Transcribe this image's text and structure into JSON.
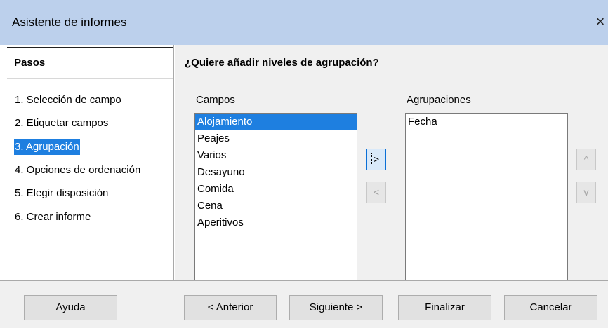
{
  "window": {
    "title": "Asistente de informes",
    "close_glyph": "×"
  },
  "steps": {
    "heading": "Pasos",
    "items": [
      {
        "label": "1. Selección de campo"
      },
      {
        "label": "2. Etiquetar campos"
      },
      {
        "label": "3. Agrupación",
        "active": true
      },
      {
        "label": "4. Opciones de ordenación"
      },
      {
        "label": "5. Elegir disposición"
      },
      {
        "label": "6. Crear informe"
      }
    ]
  },
  "main": {
    "question": "¿Quiere añadir niveles de agrupación?",
    "fields_label": "Campos",
    "fields": [
      "Alojamiento",
      "Peajes",
      "Varios",
      "Desayuno",
      "Comida",
      "Cena",
      "Aperitivos"
    ],
    "selected_field": "Alojamiento",
    "groupings_label": "Agrupaciones",
    "groupings": [
      "Fecha"
    ],
    "add_button": ">",
    "remove_button": "<",
    "up_button": "^",
    "down_button": "v"
  },
  "footer": {
    "help": "Ayuda",
    "back": "< Anterior",
    "next": "Siguiente >",
    "finish": "Finalizar",
    "cancel": "Cancelar"
  },
  "colors": {
    "titlebar": "#bcd0ec",
    "selection": "#1e7fe0",
    "panel": "#f0f0f0"
  }
}
